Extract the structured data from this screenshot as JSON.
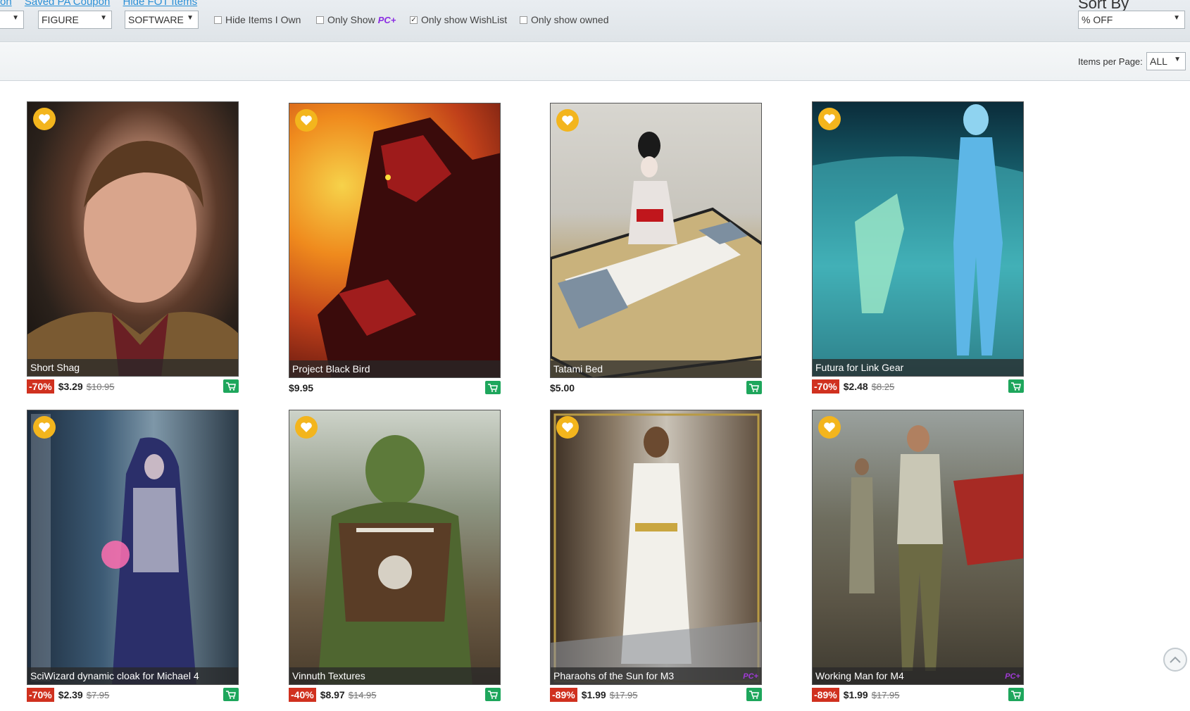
{
  "top_links": [
    "on",
    "Saved PA Coupon",
    "Hide FOT Items"
  ],
  "filters": {
    "first_select": "",
    "category_select": "FIGURE",
    "software_select": "SOFTWARE",
    "hide_items_i_own": "Hide Items I Own",
    "only_show": "Only Show",
    "only_show_badge": "PC+",
    "only_show_wishlist": "Only show WishList",
    "only_show_owned": "Only show owned"
  },
  "sort": {
    "label": "Sort By",
    "value": "% OFF"
  },
  "items_per_page": {
    "label": "Items per Page:",
    "value": "ALL"
  },
  "colors": {
    "discount": "#d0311f",
    "cart": "#1ea65c",
    "heart": "#f3b51d",
    "pc_plus": "#a13ad8",
    "link": "#2a8fd6"
  },
  "products": [
    {
      "name": "Short Shag",
      "discount": "-70%",
      "price": "$3.29",
      "original": "$10.95",
      "pc_plus": false
    },
    {
      "name": "Project Black Bird",
      "discount": "",
      "price": "$9.95",
      "original": "",
      "pc_plus": false
    },
    {
      "name": "Tatami Bed",
      "discount": "",
      "price": "$5.00",
      "original": "",
      "pc_plus": false
    },
    {
      "name": "Futura for Link Gear",
      "discount": "-70%",
      "price": "$2.48",
      "original": "$8.25",
      "pc_plus": false
    },
    {
      "name": "SciWizard dynamic cloak for Michael 4",
      "discount": "-70%",
      "price": "$2.39",
      "original": "$7.95",
      "pc_plus": false
    },
    {
      "name": "Vinnuth Textures",
      "discount": "-40%",
      "price": "$8.97",
      "original": "$14.95",
      "pc_plus": false
    },
    {
      "name": "Pharaohs of the Sun for M3",
      "discount": "-89%",
      "price": "$1.99",
      "original": "$17.95",
      "pc_plus": true
    },
    {
      "name": "Working Man for M4",
      "discount": "-89%",
      "price": "$1.99",
      "original": "$17.95",
      "pc_plus": true
    }
  ],
  "pc_badge_text": "PC+"
}
